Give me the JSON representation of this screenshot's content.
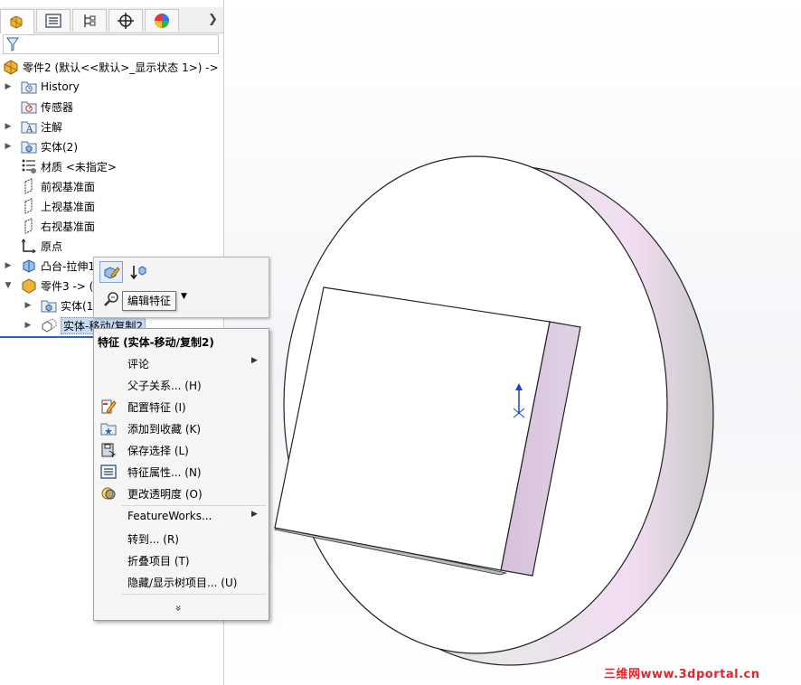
{
  "tabs": [
    "feature-manager",
    "property-manager",
    "configuration-manager",
    "dimxpert-manager",
    "display-manager"
  ],
  "tree": {
    "root": "零件2  (默认<<默认>_显示状态 1>) ->",
    "items": [
      {
        "label": "History"
      },
      {
        "label": "传感器"
      },
      {
        "label": "注解"
      },
      {
        "label": "实体(2)"
      },
      {
        "label": "材质 <未指定>"
      },
      {
        "label": "前视基准面"
      },
      {
        "label": "上视基准面"
      },
      {
        "label": "右视基准面"
      },
      {
        "label": "原点"
      },
      {
        "label": "凸台-拉伸1"
      },
      {
        "label": "零件3 -> ("
      },
      {
        "label": "实体(1"
      },
      {
        "label": "实体-移动/复制2"
      }
    ]
  },
  "toolbar": {
    "tooltip": "编辑特征"
  },
  "menu": {
    "title": "特征 (实体-移动/复制2)",
    "items": [
      {
        "label": "评论"
      },
      {
        "label": "父子关系... (H)"
      },
      {
        "label": "配置特征 (I)"
      },
      {
        "label": "添加到收藏 (K)"
      },
      {
        "label": "保存选择 (L)"
      },
      {
        "label": "特征属性... (N)"
      },
      {
        "label": "更改透明度 (O)"
      },
      {
        "label": "FeatureWorks..."
      },
      {
        "label": "转到... (R)"
      },
      {
        "label": "折叠项目 (T)"
      },
      {
        "label": "隐藏/显示树项目... (U)"
      }
    ],
    "more": "»"
  },
  "watermark": "三维网www.3dportal.cn",
  "colors": {
    "disk_rim": "#e9dcee",
    "box_side": "#dcc8e0",
    "selection": "#c7dcf4",
    "watermark": "#e3242b"
  }
}
